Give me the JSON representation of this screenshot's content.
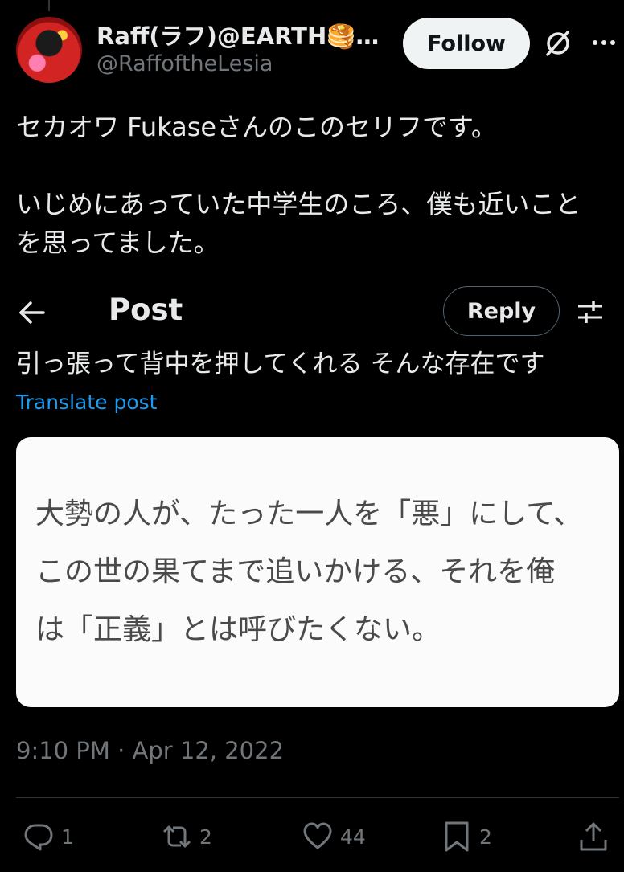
{
  "author": {
    "display_name": "Raff(ラフ)@EARTH🥞…",
    "handle": "@RaffoftheLesia",
    "follow_label": "Follow"
  },
  "tweet": {
    "line1": "セカオワ Fukaseさんのこのセリフです。",
    "line2": "いじめにあっていた中学生のころ、僕も近いこと",
    "line3": "を思ってました。",
    "partial_line": "引っ張って背中を押してくれる そんな存在です",
    "translate_label": "Translate post"
  },
  "header": {
    "title": "Post",
    "reply_label": "Reply"
  },
  "quote_image": {
    "line1": "大勢の人が、たった一人を「悪」にして、",
    "line2": "この世の果てまで追いかける、それを俺",
    "line3": "は「正義」とは呼びたくない。"
  },
  "timestamp": "9:10 PM · Apr 12, 2022",
  "actions": {
    "replies": "1",
    "reposts": "2",
    "likes": "44",
    "bookmarks": "2"
  },
  "icons": [
    "grok-icon",
    "more-icon",
    "back-icon",
    "filter-icon",
    "reply-icon",
    "repost-icon",
    "like-icon",
    "bookmark-icon",
    "share-icon"
  ],
  "colors": {
    "accent": "#1d9bf0",
    "muted": "#71767b",
    "text": "#e7e9ea"
  }
}
